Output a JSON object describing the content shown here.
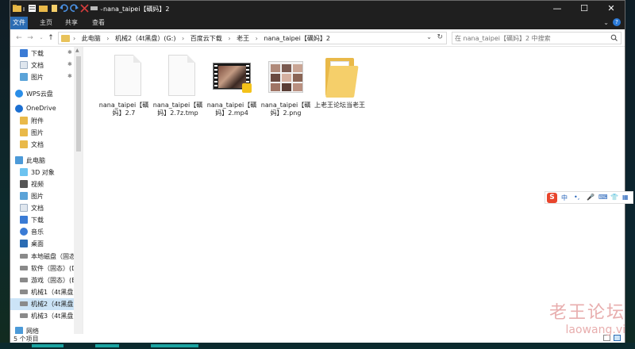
{
  "window": {
    "title": "nana_taipei【礪妈】2",
    "minimize_glyph": "—",
    "maximize_glyph": "☐",
    "close_glyph": "✕"
  },
  "ribbon": {
    "tabs": [
      {
        "label": "文件",
        "active": true
      },
      {
        "label": "主页",
        "active": false
      },
      {
        "label": "共享",
        "active": false
      },
      {
        "label": "查看",
        "active": false
      }
    ]
  },
  "address": {
    "crumbs": [
      "此电脑",
      "机械2（4t黑盘）(G:)",
      "百度云下载",
      "老王",
      "nana_taipei【礪妈】2"
    ]
  },
  "search": {
    "placeholder": "在 nana_taipei【礪妈】2 中搜索"
  },
  "nav": {
    "items": [
      {
        "label": "下载",
        "icon": "download-icon",
        "pinned": true
      },
      {
        "label": "文档",
        "icon": "document-icon",
        "pinned": true
      },
      {
        "label": "图片",
        "icon": "picture-icon",
        "pinned": true
      },
      {
        "label": "WPS云盘",
        "icon": "cloud-icon",
        "pinned": false
      },
      {
        "label": "OneDrive",
        "icon": "onedrive-icon",
        "pinned": false
      },
      {
        "label": "附件",
        "icon": "folder-icon",
        "pinned": false
      },
      {
        "label": "图片",
        "icon": "folder-icon",
        "pinned": false
      },
      {
        "label": "文档",
        "icon": "folder-icon",
        "pinned": false
      },
      {
        "label": "此电脑",
        "icon": "computer-icon",
        "pinned": false
      },
      {
        "label": "3D 对象",
        "icon": "3d-objects-icon",
        "pinned": false
      },
      {
        "label": "视频",
        "icon": "video-icon",
        "pinned": false
      },
      {
        "label": "图片",
        "icon": "picture-icon",
        "pinned": false
      },
      {
        "label": "文档",
        "icon": "document-icon",
        "pinned": false
      },
      {
        "label": "下载",
        "icon": "download-icon",
        "pinned": false
      },
      {
        "label": "音乐",
        "icon": "music-icon",
        "pinned": false
      },
      {
        "label": "桌面",
        "icon": "desktop-icon",
        "pinned": false
      },
      {
        "label": "本地磁盘（固态",
        "icon": "drive-icon",
        "pinned": false
      },
      {
        "label": "软件（固态）(D",
        "icon": "drive-icon",
        "pinned": false
      },
      {
        "label": "游戏（固态）(E",
        "icon": "drive-icon",
        "pinned": false
      },
      {
        "label": "机械1（4t黑盘）",
        "icon": "drive-icon",
        "pinned": false
      },
      {
        "label": "机械2（4t黑盘）",
        "icon": "drive-icon",
        "pinned": false,
        "selected": true
      },
      {
        "label": "机械3（4t黑盘）",
        "icon": "drive-icon",
        "pinned": false
      },
      {
        "label": "网络",
        "icon": "network-icon",
        "pinned": false
      }
    ]
  },
  "files": [
    {
      "name": "nana_taipei【礪妈】2.7",
      "type": "blank-file"
    },
    {
      "name": "nana_taipei【礪妈】2.7z.tmp",
      "type": "blank-file"
    },
    {
      "name": "nana_taipei【礪妈】2.mp4",
      "type": "video"
    },
    {
      "name": "nana_taipei【礪妈】2.png",
      "type": "image"
    },
    {
      "name": "上老王论坛当老王",
      "type": "folder"
    }
  ],
  "status": {
    "count": "5 个项目"
  },
  "ime": {
    "logo": "S",
    "items": [
      "中",
      "•,",
      "🎤",
      "⌨",
      "👕",
      "▦"
    ]
  },
  "watermark": {
    "title": "老王论坛",
    "url": "laowang.vi"
  },
  "colors": {
    "accent": "#2b6cb3",
    "titlebar": "#1f1f1f",
    "folder": "#e9b949",
    "selected_row": "#cce4f7"
  }
}
